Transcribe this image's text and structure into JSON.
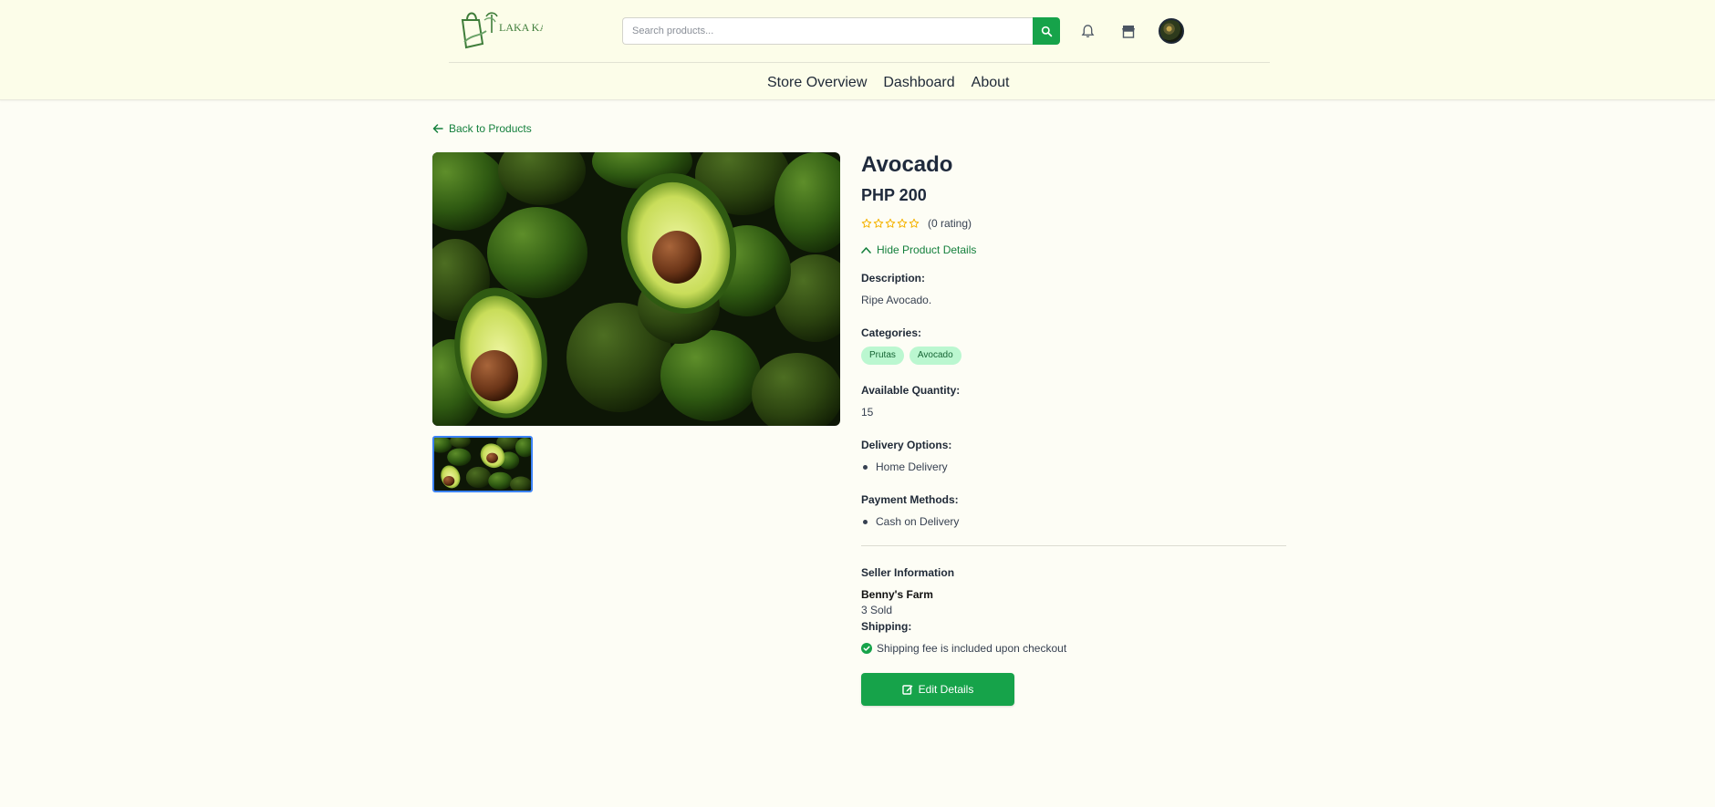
{
  "header": {
    "logo_text": "LAKA KATI",
    "search_placeholder": "Search products...",
    "nav": [
      "Store Overview",
      "Dashboard",
      "About"
    ]
  },
  "back_label": "Back to Products",
  "product": {
    "name": "Avocado",
    "price": "PHP 200",
    "rating_text": "(0 rating)",
    "rating_stars": 0,
    "toggle_label": "Hide Product Details",
    "description_label": "Description:",
    "description": "Ripe Avocado.",
    "categories_label": "Categories:",
    "categories": [
      "Prutas",
      "Avocado"
    ],
    "quantity_label": "Available Quantity:",
    "quantity": "15",
    "delivery_label": "Delivery Options:",
    "delivery_options": [
      "Home Delivery"
    ],
    "payment_label": "Payment Methods:",
    "payment_methods": [
      "Cash on Delivery"
    ]
  },
  "seller": {
    "section_label": "Seller Information",
    "name": "Benny's Farm",
    "sold": "3 Sold",
    "shipping_label": "Shipping:",
    "shipping_note": "Shipping fee is included upon checkout"
  },
  "edit_button": "Edit Details",
  "colors": {
    "accent": "#16a34a",
    "link": "#15803d",
    "chip_bg": "#bbf7d0",
    "star": "#f5b301"
  },
  "icons": [
    "search-icon",
    "bell-icon",
    "store-icon",
    "arrow-left-icon",
    "star-outline-icon",
    "chevron-up-icon",
    "check-circle-icon",
    "edit-icon"
  ]
}
